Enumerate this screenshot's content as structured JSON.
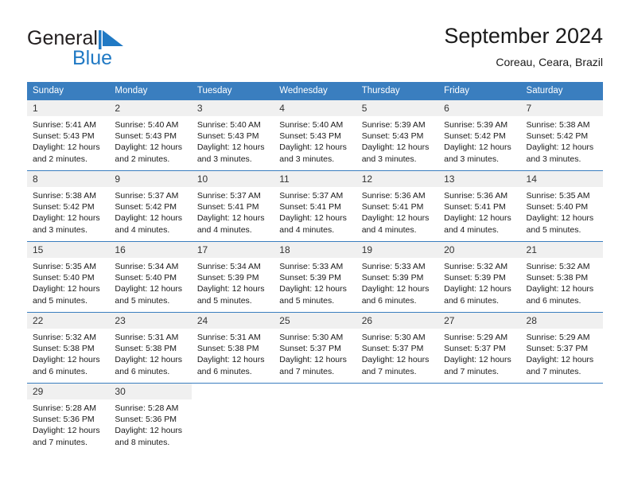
{
  "brand": {
    "word_one": "General",
    "word_two": "Blue",
    "flag_icon": "blue-triangle-flag-icon",
    "accent_color": "#2079c4"
  },
  "header": {
    "title": "September 2024",
    "subtitle": "Coreau, Ceara, Brazil"
  },
  "calendar": {
    "header_bg": "#3a7ebf",
    "daynum_bg": "#f0f0f0",
    "weekday_headers": [
      "Sunday",
      "Monday",
      "Tuesday",
      "Wednesday",
      "Thursday",
      "Friday",
      "Saturday"
    ],
    "labels": {
      "sunrise": "Sunrise:",
      "sunset": "Sunset:",
      "daylight": "Daylight:"
    },
    "weeks": [
      [
        {
          "day": "1",
          "sunrise": "Sunrise: 5:41 AM",
          "sunset": "Sunset: 5:43 PM",
          "daylight_1": "Daylight: 12 hours",
          "daylight_2": "and 2 minutes."
        },
        {
          "day": "2",
          "sunrise": "Sunrise: 5:40 AM",
          "sunset": "Sunset: 5:43 PM",
          "daylight_1": "Daylight: 12 hours",
          "daylight_2": "and 2 minutes."
        },
        {
          "day": "3",
          "sunrise": "Sunrise: 5:40 AM",
          "sunset": "Sunset: 5:43 PM",
          "daylight_1": "Daylight: 12 hours",
          "daylight_2": "and 3 minutes."
        },
        {
          "day": "4",
          "sunrise": "Sunrise: 5:40 AM",
          "sunset": "Sunset: 5:43 PM",
          "daylight_1": "Daylight: 12 hours",
          "daylight_2": "and 3 minutes."
        },
        {
          "day": "5",
          "sunrise": "Sunrise: 5:39 AM",
          "sunset": "Sunset: 5:43 PM",
          "daylight_1": "Daylight: 12 hours",
          "daylight_2": "and 3 minutes."
        },
        {
          "day": "6",
          "sunrise": "Sunrise: 5:39 AM",
          "sunset": "Sunset: 5:42 PM",
          "daylight_1": "Daylight: 12 hours",
          "daylight_2": "and 3 minutes."
        },
        {
          "day": "7",
          "sunrise": "Sunrise: 5:38 AM",
          "sunset": "Sunset: 5:42 PM",
          "daylight_1": "Daylight: 12 hours",
          "daylight_2": "and 3 minutes."
        }
      ],
      [
        {
          "day": "8",
          "sunrise": "Sunrise: 5:38 AM",
          "sunset": "Sunset: 5:42 PM",
          "daylight_1": "Daylight: 12 hours",
          "daylight_2": "and 3 minutes."
        },
        {
          "day": "9",
          "sunrise": "Sunrise: 5:37 AM",
          "sunset": "Sunset: 5:42 PM",
          "daylight_1": "Daylight: 12 hours",
          "daylight_2": "and 4 minutes."
        },
        {
          "day": "10",
          "sunrise": "Sunrise: 5:37 AM",
          "sunset": "Sunset: 5:41 PM",
          "daylight_1": "Daylight: 12 hours",
          "daylight_2": "and 4 minutes."
        },
        {
          "day": "11",
          "sunrise": "Sunrise: 5:37 AM",
          "sunset": "Sunset: 5:41 PM",
          "daylight_1": "Daylight: 12 hours",
          "daylight_2": "and 4 minutes."
        },
        {
          "day": "12",
          "sunrise": "Sunrise: 5:36 AM",
          "sunset": "Sunset: 5:41 PM",
          "daylight_1": "Daylight: 12 hours",
          "daylight_2": "and 4 minutes."
        },
        {
          "day": "13",
          "sunrise": "Sunrise: 5:36 AM",
          "sunset": "Sunset: 5:41 PM",
          "daylight_1": "Daylight: 12 hours",
          "daylight_2": "and 4 minutes."
        },
        {
          "day": "14",
          "sunrise": "Sunrise: 5:35 AM",
          "sunset": "Sunset: 5:40 PM",
          "daylight_1": "Daylight: 12 hours",
          "daylight_2": "and 5 minutes."
        }
      ],
      [
        {
          "day": "15",
          "sunrise": "Sunrise: 5:35 AM",
          "sunset": "Sunset: 5:40 PM",
          "daylight_1": "Daylight: 12 hours",
          "daylight_2": "and 5 minutes."
        },
        {
          "day": "16",
          "sunrise": "Sunrise: 5:34 AM",
          "sunset": "Sunset: 5:40 PM",
          "daylight_1": "Daylight: 12 hours",
          "daylight_2": "and 5 minutes."
        },
        {
          "day": "17",
          "sunrise": "Sunrise: 5:34 AM",
          "sunset": "Sunset: 5:39 PM",
          "daylight_1": "Daylight: 12 hours",
          "daylight_2": "and 5 minutes."
        },
        {
          "day": "18",
          "sunrise": "Sunrise: 5:33 AM",
          "sunset": "Sunset: 5:39 PM",
          "daylight_1": "Daylight: 12 hours",
          "daylight_2": "and 5 minutes."
        },
        {
          "day": "19",
          "sunrise": "Sunrise: 5:33 AM",
          "sunset": "Sunset: 5:39 PM",
          "daylight_1": "Daylight: 12 hours",
          "daylight_2": "and 6 minutes."
        },
        {
          "day": "20",
          "sunrise": "Sunrise: 5:32 AM",
          "sunset": "Sunset: 5:39 PM",
          "daylight_1": "Daylight: 12 hours",
          "daylight_2": "and 6 minutes."
        },
        {
          "day": "21",
          "sunrise": "Sunrise: 5:32 AM",
          "sunset": "Sunset: 5:38 PM",
          "daylight_1": "Daylight: 12 hours",
          "daylight_2": "and 6 minutes."
        }
      ],
      [
        {
          "day": "22",
          "sunrise": "Sunrise: 5:32 AM",
          "sunset": "Sunset: 5:38 PM",
          "daylight_1": "Daylight: 12 hours",
          "daylight_2": "and 6 minutes."
        },
        {
          "day": "23",
          "sunrise": "Sunrise: 5:31 AM",
          "sunset": "Sunset: 5:38 PM",
          "daylight_1": "Daylight: 12 hours",
          "daylight_2": "and 6 minutes."
        },
        {
          "day": "24",
          "sunrise": "Sunrise: 5:31 AM",
          "sunset": "Sunset: 5:38 PM",
          "daylight_1": "Daylight: 12 hours",
          "daylight_2": "and 6 minutes."
        },
        {
          "day": "25",
          "sunrise": "Sunrise: 5:30 AM",
          "sunset": "Sunset: 5:37 PM",
          "daylight_1": "Daylight: 12 hours",
          "daylight_2": "and 7 minutes."
        },
        {
          "day": "26",
          "sunrise": "Sunrise: 5:30 AM",
          "sunset": "Sunset: 5:37 PM",
          "daylight_1": "Daylight: 12 hours",
          "daylight_2": "and 7 minutes."
        },
        {
          "day": "27",
          "sunrise": "Sunrise: 5:29 AM",
          "sunset": "Sunset: 5:37 PM",
          "daylight_1": "Daylight: 12 hours",
          "daylight_2": "and 7 minutes."
        },
        {
          "day": "28",
          "sunrise": "Sunrise: 5:29 AM",
          "sunset": "Sunset: 5:37 PM",
          "daylight_1": "Daylight: 12 hours",
          "daylight_2": "and 7 minutes."
        }
      ],
      [
        {
          "day": "29",
          "sunrise": "Sunrise: 5:28 AM",
          "sunset": "Sunset: 5:36 PM",
          "daylight_1": "Daylight: 12 hours",
          "daylight_2": "and 7 minutes."
        },
        {
          "day": "30",
          "sunrise": "Sunrise: 5:28 AM",
          "sunset": "Sunset: 5:36 PM",
          "daylight_1": "Daylight: 12 hours",
          "daylight_2": "and 8 minutes."
        },
        {
          "day": "",
          "sunrise": "",
          "sunset": "",
          "daylight_1": "",
          "daylight_2": ""
        },
        {
          "day": "",
          "sunrise": "",
          "sunset": "",
          "daylight_1": "",
          "daylight_2": ""
        },
        {
          "day": "",
          "sunrise": "",
          "sunset": "",
          "daylight_1": "",
          "daylight_2": ""
        },
        {
          "day": "",
          "sunrise": "",
          "sunset": "",
          "daylight_1": "",
          "daylight_2": ""
        },
        {
          "day": "",
          "sunrise": "",
          "sunset": "",
          "daylight_1": "",
          "daylight_2": ""
        }
      ]
    ]
  }
}
